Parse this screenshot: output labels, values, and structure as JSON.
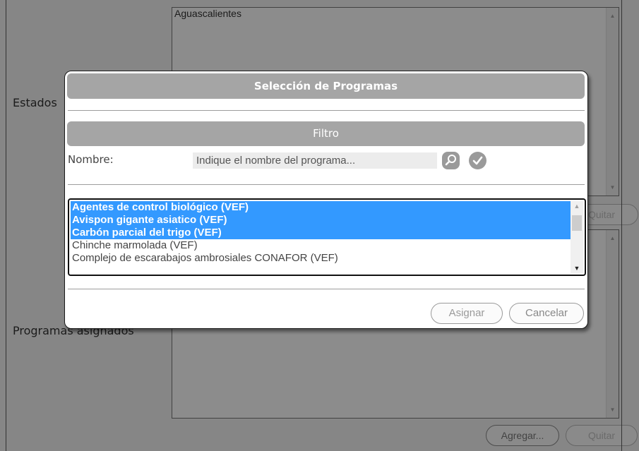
{
  "background": {
    "states_label": "Estados",
    "programs_label": "Programas asignados",
    "states_list": [
      "Aguascalientes"
    ],
    "quitar_states_label": "Quitar",
    "agregar_label": "Agregar...",
    "quitar_programs_label": "Quitar"
  },
  "dialog": {
    "title": "Selección de Programas",
    "filter_title": "Filtro",
    "name_label": "Nombre:",
    "name_placeholder": "Indique el nombre del programa...",
    "search_icon": "search-icon",
    "confirm_icon": "check-icon",
    "programs": [
      {
        "label": "Agentes de control biológico (VEF)",
        "selected": true
      },
      {
        "label": "Avispon gigante asiatico (VEF)",
        "selected": true
      },
      {
        "label": "Carbón parcial del trigo (VEF)",
        "selected": true
      },
      {
        "label": "Chinche marmolada (VEF)",
        "selected": false
      },
      {
        "label": "Complejo de escarabajos ambrosiales CONAFOR (VEF)",
        "selected": false
      }
    ],
    "assign_label": "Asignar",
    "cancel_label": "Cancelar"
  },
  "colors": {
    "selection": "#3399ff",
    "header_bar": "#a5a5a5",
    "overlay": "rgba(0,0,0,0.45)"
  }
}
